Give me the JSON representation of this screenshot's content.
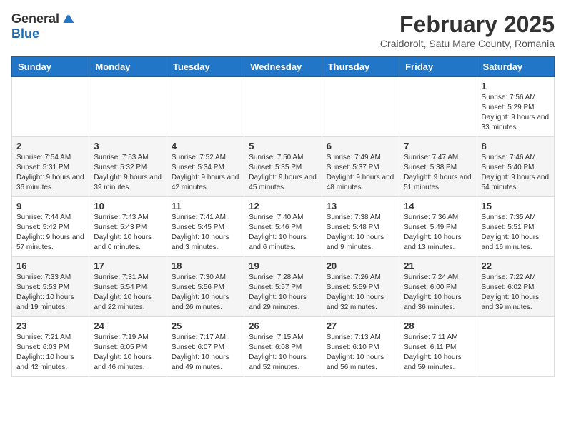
{
  "header": {
    "logo_general": "General",
    "logo_blue": "Blue",
    "month_title": "February 2025",
    "location": "Craidorolt, Satu Mare County, Romania"
  },
  "weekdays": [
    "Sunday",
    "Monday",
    "Tuesday",
    "Wednesday",
    "Thursday",
    "Friday",
    "Saturday"
  ],
  "weeks": [
    [
      null,
      null,
      null,
      null,
      null,
      null,
      {
        "day": "1",
        "sunrise": "7:56 AM",
        "sunset": "5:29 PM",
        "daylight": "9 hours and 33 minutes."
      }
    ],
    [
      {
        "day": "2",
        "sunrise": "7:54 AM",
        "sunset": "5:31 PM",
        "daylight": "9 hours and 36 minutes."
      },
      {
        "day": "3",
        "sunrise": "7:53 AM",
        "sunset": "5:32 PM",
        "daylight": "9 hours and 39 minutes."
      },
      {
        "day": "4",
        "sunrise": "7:52 AM",
        "sunset": "5:34 PM",
        "daylight": "9 hours and 42 minutes."
      },
      {
        "day": "5",
        "sunrise": "7:50 AM",
        "sunset": "5:35 PM",
        "daylight": "9 hours and 45 minutes."
      },
      {
        "day": "6",
        "sunrise": "7:49 AM",
        "sunset": "5:37 PM",
        "daylight": "9 hours and 48 minutes."
      },
      {
        "day": "7",
        "sunrise": "7:47 AM",
        "sunset": "5:38 PM",
        "daylight": "9 hours and 51 minutes."
      },
      {
        "day": "8",
        "sunrise": "7:46 AM",
        "sunset": "5:40 PM",
        "daylight": "9 hours and 54 minutes."
      }
    ],
    [
      {
        "day": "9",
        "sunrise": "7:44 AM",
        "sunset": "5:42 PM",
        "daylight": "9 hours and 57 minutes."
      },
      {
        "day": "10",
        "sunrise": "7:43 AM",
        "sunset": "5:43 PM",
        "daylight": "10 hours and 0 minutes."
      },
      {
        "day": "11",
        "sunrise": "7:41 AM",
        "sunset": "5:45 PM",
        "daylight": "10 hours and 3 minutes."
      },
      {
        "day": "12",
        "sunrise": "7:40 AM",
        "sunset": "5:46 PM",
        "daylight": "10 hours and 6 minutes."
      },
      {
        "day": "13",
        "sunrise": "7:38 AM",
        "sunset": "5:48 PM",
        "daylight": "10 hours and 9 minutes."
      },
      {
        "day": "14",
        "sunrise": "7:36 AM",
        "sunset": "5:49 PM",
        "daylight": "10 hours and 13 minutes."
      },
      {
        "day": "15",
        "sunrise": "7:35 AM",
        "sunset": "5:51 PM",
        "daylight": "10 hours and 16 minutes."
      }
    ],
    [
      {
        "day": "16",
        "sunrise": "7:33 AM",
        "sunset": "5:53 PM",
        "daylight": "10 hours and 19 minutes."
      },
      {
        "day": "17",
        "sunrise": "7:31 AM",
        "sunset": "5:54 PM",
        "daylight": "10 hours and 22 minutes."
      },
      {
        "day": "18",
        "sunrise": "7:30 AM",
        "sunset": "5:56 PM",
        "daylight": "10 hours and 26 minutes."
      },
      {
        "day": "19",
        "sunrise": "7:28 AM",
        "sunset": "5:57 PM",
        "daylight": "10 hours and 29 minutes."
      },
      {
        "day": "20",
        "sunrise": "7:26 AM",
        "sunset": "5:59 PM",
        "daylight": "10 hours and 32 minutes."
      },
      {
        "day": "21",
        "sunrise": "7:24 AM",
        "sunset": "6:00 PM",
        "daylight": "10 hours and 36 minutes."
      },
      {
        "day": "22",
        "sunrise": "7:22 AM",
        "sunset": "6:02 PM",
        "daylight": "10 hours and 39 minutes."
      }
    ],
    [
      {
        "day": "23",
        "sunrise": "7:21 AM",
        "sunset": "6:03 PM",
        "daylight": "10 hours and 42 minutes."
      },
      {
        "day": "24",
        "sunrise": "7:19 AM",
        "sunset": "6:05 PM",
        "daylight": "10 hours and 46 minutes."
      },
      {
        "day": "25",
        "sunrise": "7:17 AM",
        "sunset": "6:07 PM",
        "daylight": "10 hours and 49 minutes."
      },
      {
        "day": "26",
        "sunrise": "7:15 AM",
        "sunset": "6:08 PM",
        "daylight": "10 hours and 52 minutes."
      },
      {
        "day": "27",
        "sunrise": "7:13 AM",
        "sunset": "6:10 PM",
        "daylight": "10 hours and 56 minutes."
      },
      {
        "day": "28",
        "sunrise": "7:11 AM",
        "sunset": "6:11 PM",
        "daylight": "10 hours and 59 minutes."
      },
      null
    ]
  ]
}
